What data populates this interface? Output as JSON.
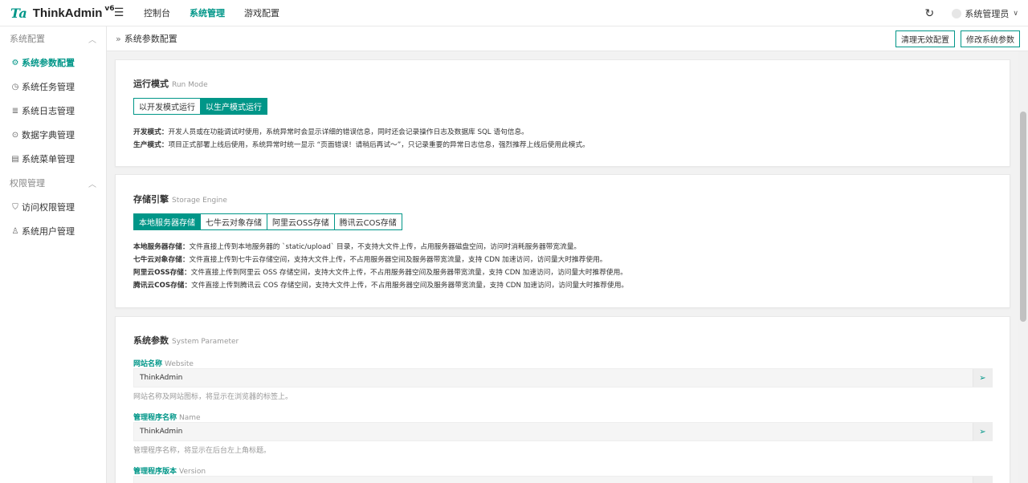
{
  "app": {
    "logo_mark": "Ta",
    "name": "ThinkAdmin",
    "version": "v6"
  },
  "topnav": [
    {
      "label": "控制台"
    },
    {
      "label": "系统管理"
    },
    {
      "label": "游戏配置"
    }
  ],
  "user": {
    "name": "系统管理员"
  },
  "sidebar": {
    "group1": "系统配置",
    "items1": [
      {
        "label": "系统参数配置",
        "icon": "gear-icon"
      },
      {
        "label": "系统任务管理",
        "icon": "clock-icon"
      },
      {
        "label": "系统日志管理",
        "icon": "list-icon"
      },
      {
        "label": "数据字典管理",
        "icon": "dots-icon"
      },
      {
        "label": "系统菜单管理",
        "icon": "menu-icon"
      }
    ],
    "group2": "权限管理",
    "items2": [
      {
        "label": "访问权限管理",
        "icon": "shield-icon"
      },
      {
        "label": "系统用户管理",
        "icon": "user-icon"
      }
    ]
  },
  "breadcrumb": {
    "label": "系统参数配置"
  },
  "actions": {
    "clear": "清理无效配置",
    "edit": "修改系统参数"
  },
  "run_mode": {
    "title": "运行模式",
    "title_en": "Run Mode",
    "options": [
      "以开发模式运行",
      "以生产模式运行"
    ],
    "active": 1,
    "desc": [
      {
        "k": "开发模式：",
        "v": "开发人员或在功能调试时使用，系统异常时会显示详细的错误信息，同时还会记录操作日志及数据库 SQL 语句信息。"
      },
      {
        "k": "生产模式：",
        "v": "项目正式部署上线后使用，系统异常时统一显示 “页面错误！请稍后再试～”，只记录重要的异常日志信息，强烈推荐上线后使用此模式。"
      }
    ]
  },
  "storage": {
    "title": "存储引擎",
    "title_en": "Storage Engine",
    "options": [
      "本地服务器存储",
      "七牛云对象存储",
      "阿里云OSS存储",
      "腾讯云COS存储"
    ],
    "active": 0,
    "desc": [
      {
        "k": "本地服务器存储：",
        "v": "文件直接上传到本地服务器的 `static/upload` 目录，不支持大文件上传，占用服务器磁盘空间，访问时消耗服务器带宽流量。"
      },
      {
        "k": "七牛云对象存储：",
        "v": "文件直接上传到七牛云存储空间，支持大文件上传，不占用服务器空间及服务器带宽流量，支持 CDN 加速访问，访问量大时推荐使用。"
      },
      {
        "k": "阿里云OSS存储：",
        "v": "文件直接上传到阿里云 OSS 存储空间，支持大文件上传，不占用服务器空间及服务器带宽流量，支持 CDN 加速访问，访问量大时推荐使用。"
      },
      {
        "k": "腾讯云COS存储：",
        "v": "文件直接上传到腾讯云 COS 存储空间，支持大文件上传，不占用服务器空间及服务器带宽流量，支持 CDN 加速访问，访问量大时推荐使用。"
      }
    ]
  },
  "sysparam": {
    "title": "系统参数",
    "title_en": "System Parameter",
    "fields": [
      {
        "label": "网站名称",
        "label_en": "Website",
        "value": "ThinkAdmin",
        "help": "网站名称及网站图标，将显示在浏览器的标签上。"
      },
      {
        "label": "管理程序名称",
        "label_en": "Name",
        "value": "ThinkAdmin",
        "help": "管理程序名称，将显示在后台左上角标题。"
      },
      {
        "label": "管理程序版本",
        "label_en": "Version",
        "value": "",
        "help": ""
      }
    ]
  }
}
